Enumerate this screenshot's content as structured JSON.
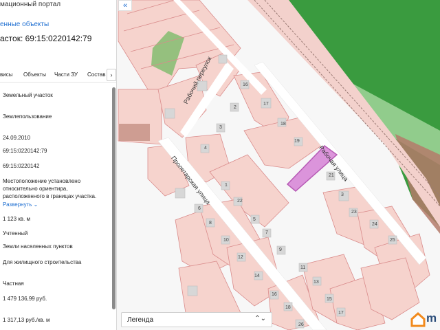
{
  "panel": {
    "portal_title": "мационный портал",
    "objects_link": "енные объекты",
    "parcel_title": "асток: 69:15:0220142:79",
    "tabs": [
      "висы",
      "Объекты",
      "Части ЗУ",
      "Состав"
    ],
    "tab_next": "›",
    "rows": [
      "Земельный участок",
      "Землепользование",
      "24.09.2010",
      "69:15:0220142:79",
      "69:15:0220142",
      "Местоположение установлено относительно ориентира, расположенного в границах участка.",
      "Развернуть",
      "1 123 кв. м",
      "Учтенный",
      "Земли населенных пунктов",
      "Для жилищного строительства",
      "Частная",
      "1 479 136,99 руб.",
      "1 317,13 руб./кв. м"
    ]
  },
  "map": {
    "collapse_icon": "«",
    "streets": [
      "Рабочий переулок",
      "Рабочая улица",
      "Пролетарская улица"
    ],
    "lot_numbers": [
      "16",
      "17",
      "2",
      "18",
      "3",
      "19",
      "4",
      "1",
      "21",
      "22",
      "3",
      "23",
      "6",
      "5",
      "24",
      "8",
      "7",
      "25",
      "10",
      "9",
      "12",
      "11",
      "14",
      "13",
      "16",
      "15",
      "18",
      "17",
      "26"
    ],
    "legend_label": "Легенда",
    "legend_arrow": "⌃⌄",
    "brand_text": "m",
    "colors": {
      "parcel_fill": "#f6d3cd",
      "parcel_stroke": "#d98b8b",
      "green_zone": "#3a9b3f",
      "light_green": "#a8d8a0",
      "selected": "#b04aae",
      "road": "#ffffff",
      "brown": "#b47a6a",
      "accent": "#1f6fd1"
    }
  }
}
